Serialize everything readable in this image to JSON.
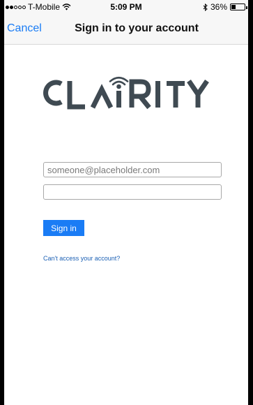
{
  "status_bar": {
    "carrier": "T-Mobile",
    "signal_bars_filled": 2,
    "signal_bars_total": 5,
    "time": "5:09 PM",
    "battery_percent": "36%",
    "battery_level": 0.36
  },
  "nav": {
    "cancel_label": "Cancel",
    "title": "Sign in to your account"
  },
  "logo": {
    "text": "CLARITY",
    "color": "#3f4a52"
  },
  "form": {
    "email_placeholder": "someone@placeholder.com",
    "email_value": "",
    "password_value": "",
    "signin_label": "Sign in",
    "help_link": "Can't access your account?"
  },
  "colors": {
    "accent": "#1a7cf5",
    "link": "#1a5fb4"
  }
}
